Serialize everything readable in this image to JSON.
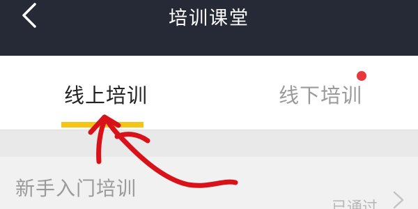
{
  "header": {
    "title": "培训课堂",
    "back_icon": "chevron-left-icon"
  },
  "tabs": [
    {
      "label": "线上培训",
      "active": true
    },
    {
      "label": "线下培训",
      "active": false,
      "has_badge": true
    }
  ],
  "colors": {
    "header_bg": "#262a36",
    "active_indicator": "#f5c418",
    "badge": "#e8373d",
    "annotation_arrow": "#d9121a"
  },
  "course_list": [
    {
      "title": "新手入门培训",
      "status": "已通过"
    }
  ]
}
